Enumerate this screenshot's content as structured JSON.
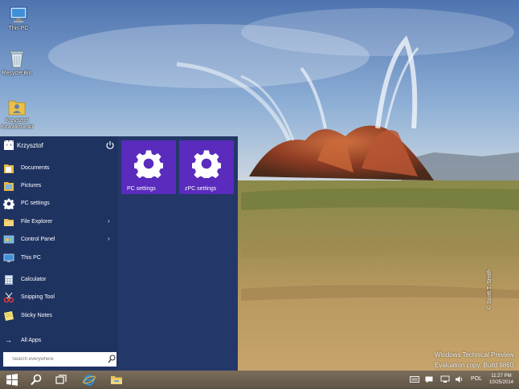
{
  "desktop": {
    "icons": [
      {
        "label": "This PC",
        "icon": "monitor-icon"
      },
      {
        "label": "Recycle Bin",
        "icon": "recycle-bin-icon"
      },
      {
        "label": "Krzysztof Kowalkowski",
        "icon": "user-folder-icon"
      }
    ],
    "watermark_line1": "Windows Technical Preview",
    "watermark_line2": "Evaluation copy. Build 9860",
    "photo_credit": "© Scott T. Smith"
  },
  "start_menu": {
    "user_name": "Krzysztof",
    "avatar_text_line1": "K S Z",
    "avatar_text_line2": "Y S",
    "items": [
      {
        "label": "Documents",
        "icon": "documents-folder-icon"
      },
      {
        "label": "Pictures",
        "icon": "pictures-folder-icon"
      },
      {
        "label": "PC settings",
        "icon": "gear-icon"
      },
      {
        "label": "File Explorer",
        "icon": "file-explorer-icon",
        "has_submenu": true
      },
      {
        "label": "Control Panel",
        "icon": "control-panel-icon",
        "has_submenu": true
      },
      {
        "label": "This PC",
        "icon": "monitor-icon"
      },
      {
        "label": "Calculator",
        "icon": "calculator-icon"
      },
      {
        "label": "Snipping Tool",
        "icon": "scissors-icon"
      },
      {
        "label": "Sticky Notes",
        "icon": "sticky-note-icon"
      }
    ],
    "chevron": "›",
    "all_apps_arrow": "→",
    "all_apps_label": "All Apps",
    "search_placeholder": "Search everywhere",
    "tiles": [
      {
        "label": "PC settings",
        "icon": "gear-icon"
      },
      {
        "label": "zPC settings",
        "icon": "gear-icon"
      }
    ],
    "tile_color": "#5a2bbd",
    "menu_color": "#233868"
  },
  "taskbar": {
    "buttons": [
      "windows-logo-icon",
      "search-icon",
      "task-view-icon",
      "internet-explorer-icon",
      "file-explorer-icon"
    ],
    "tray_language": "POL",
    "tray_time": "11:27 PM",
    "tray_date": "10/25/2014"
  }
}
